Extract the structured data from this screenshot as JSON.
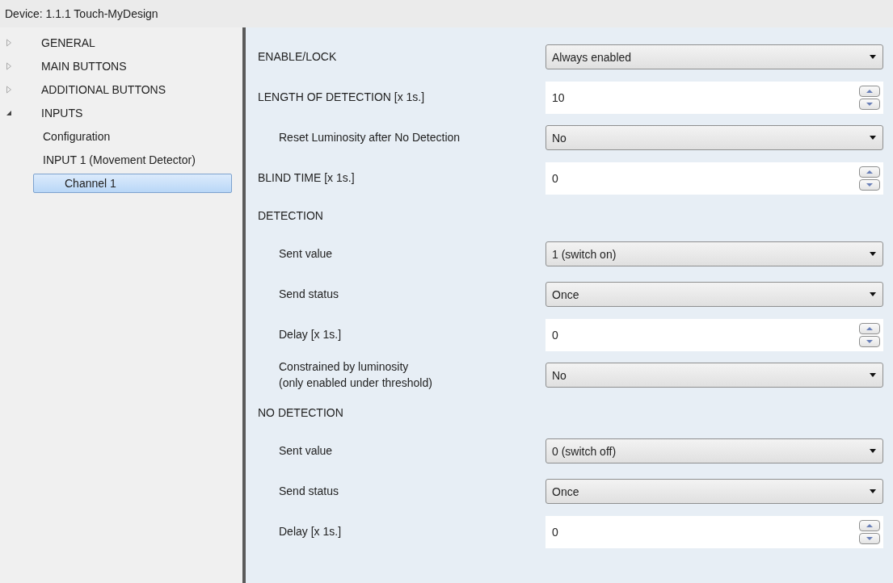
{
  "window": {
    "title": "Device: 1.1.1  Touch-MyDesign"
  },
  "tree": [
    {
      "label": "GENERAL",
      "expanded": false,
      "selected": false
    },
    {
      "label": "MAIN BUTTONS",
      "expanded": false,
      "selected": false
    },
    {
      "label": "ADDITIONAL BUTTONS",
      "expanded": false,
      "selected": false
    },
    {
      "label": "INPUTS",
      "expanded": true,
      "selected": false,
      "children": [
        {
          "label": "Configuration",
          "selected": false
        },
        {
          "label": "INPUT 1 (Movement Detector)",
          "selected": false,
          "children": [
            {
              "label": "Channel 1",
              "selected": true
            }
          ]
        }
      ]
    }
  ],
  "parameters": [
    {
      "kind": "dropdown",
      "label": "ENABLE/LOCK",
      "value": "Always enabled"
    },
    {
      "kind": "spinner",
      "label": "LENGTH OF DETECTION [x 1s.]",
      "value": "10",
      "children": [
        {
          "kind": "dropdown",
          "label": "Reset Luminosity after No Detection",
          "value": "No"
        }
      ]
    },
    {
      "kind": "spinner",
      "label": "BLIND TIME [x 1s.]",
      "value": "0"
    },
    {
      "kind": "section",
      "label": "DETECTION",
      "children": [
        {
          "kind": "dropdown",
          "label": "Sent value",
          "value": "1 (switch on)"
        },
        {
          "kind": "dropdown",
          "label": "Send status",
          "value": "Once"
        },
        {
          "kind": "spinner",
          "label": "Delay [x 1s.]",
          "value": "0"
        },
        {
          "kind": "dropdown",
          "label": "Constrained by luminosity\n(only enabled under threshold)",
          "value": "No"
        }
      ]
    },
    {
      "kind": "section",
      "label": "NO DETECTION",
      "children": [
        {
          "kind": "dropdown",
          "label": "Sent value",
          "value": "0 (switch off)"
        },
        {
          "kind": "dropdown",
          "label": "Send status",
          "value": "Once"
        },
        {
          "kind": "spinner",
          "label": "Delay [x 1s.]",
          "value": "0"
        }
      ]
    }
  ]
}
